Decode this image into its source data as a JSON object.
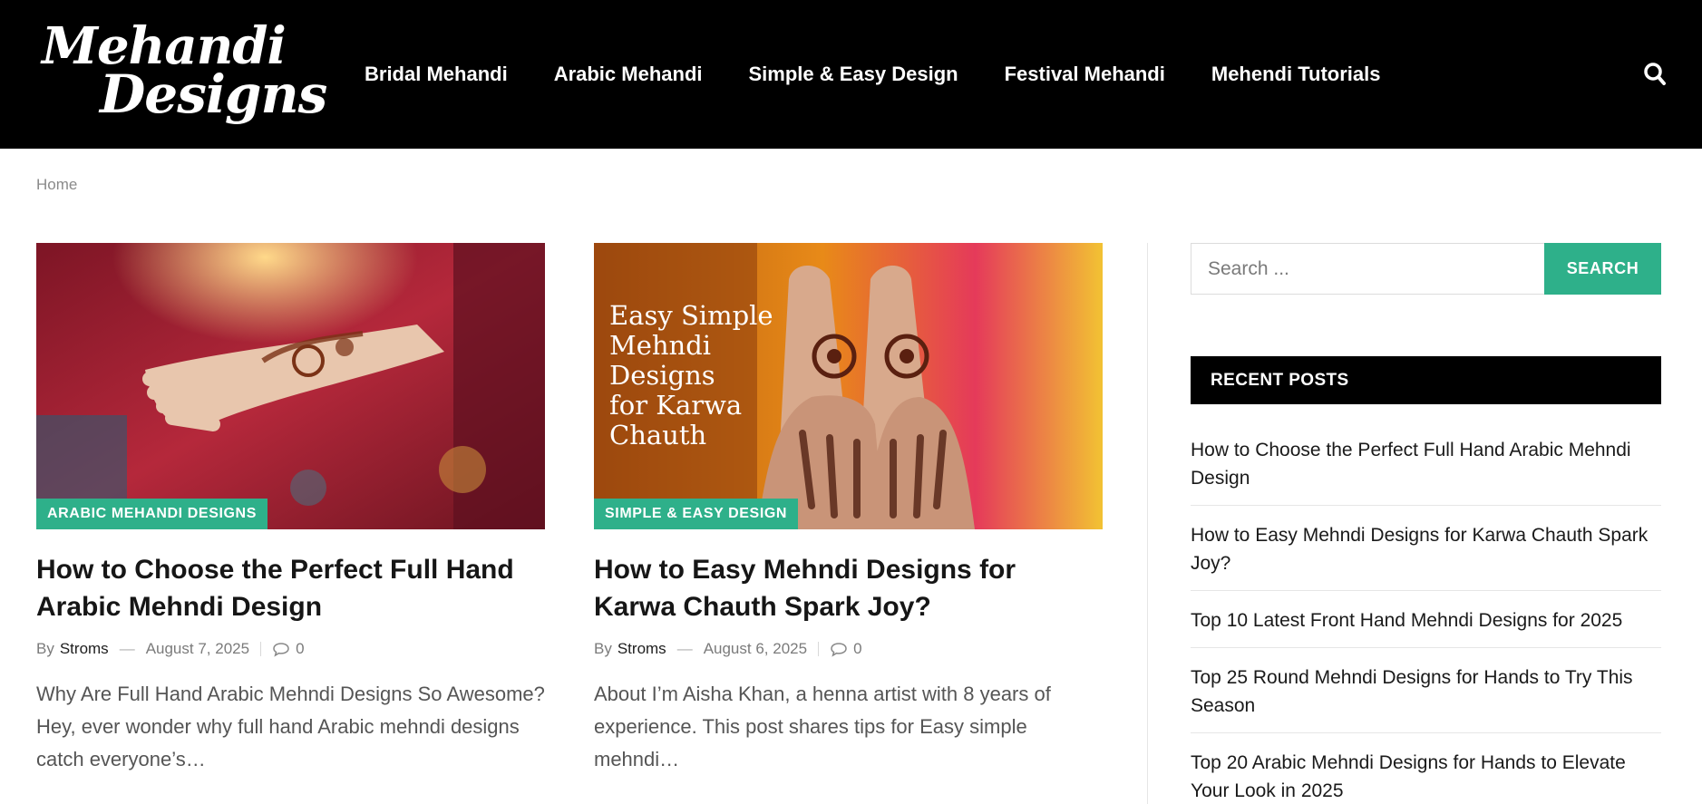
{
  "site": {
    "logo_line1": "Mehandi",
    "logo_line2": "Designs"
  },
  "nav": {
    "items": [
      "Bridal Mehandi",
      "Arabic Mehandi",
      "Simple & Easy Design",
      "Festival Mehandi",
      "Mehendi Tutorials"
    ],
    "search_icon": "search-icon"
  },
  "breadcrumb": {
    "home": "Home"
  },
  "posts": [
    {
      "category": "ARABIC MEHANDI DESIGNS",
      "title": "How to Choose the Perfect Full Hand Arabic Mehndi Design",
      "by": "By",
      "author": "Stroms",
      "date": "August 7, 2025",
      "comments": "0",
      "excerpt": "Why Are Full Hand Arabic Mehndi Designs So Awesome? Hey, ever wonder why full hand Arabic mehndi designs catch everyone’s…"
    },
    {
      "category": "SIMPLE & EASY DESIGN",
      "title": "How to Easy Mehndi Designs for Karwa Chauth Spark Joy?",
      "by": "By",
      "author": "Stroms",
      "date": "August 6, 2025",
      "comments": "0",
      "excerpt": "About I’m Aisha Khan, a henna artist with 8 years of experience. This post shares tips for Easy simple mehndi…",
      "image_text": [
        "Easy Simple",
        "Mehndi",
        "Designs",
        "for Karwa",
        "Chauth"
      ]
    }
  ],
  "sidebar": {
    "search_placeholder": "Search ...",
    "search_button": "SEARCH",
    "recent_heading": "RECENT POSTS",
    "recent_posts": [
      "How to Choose the Perfect Full Hand Arabic Mehndi Design",
      "How to Easy Mehndi Designs for Karwa Chauth Spark Joy?",
      "Top 10 Latest Front Hand Mehndi Designs for 2025",
      "Top 25 Round Mehndi Designs for Hands to Try This Season",
      "Top 20 Arabic Mehndi Designs for Hands to Elevate Your Look in 2025"
    ]
  },
  "colors": {
    "accent": "#2eb08a",
    "header_bg": "#000000"
  }
}
